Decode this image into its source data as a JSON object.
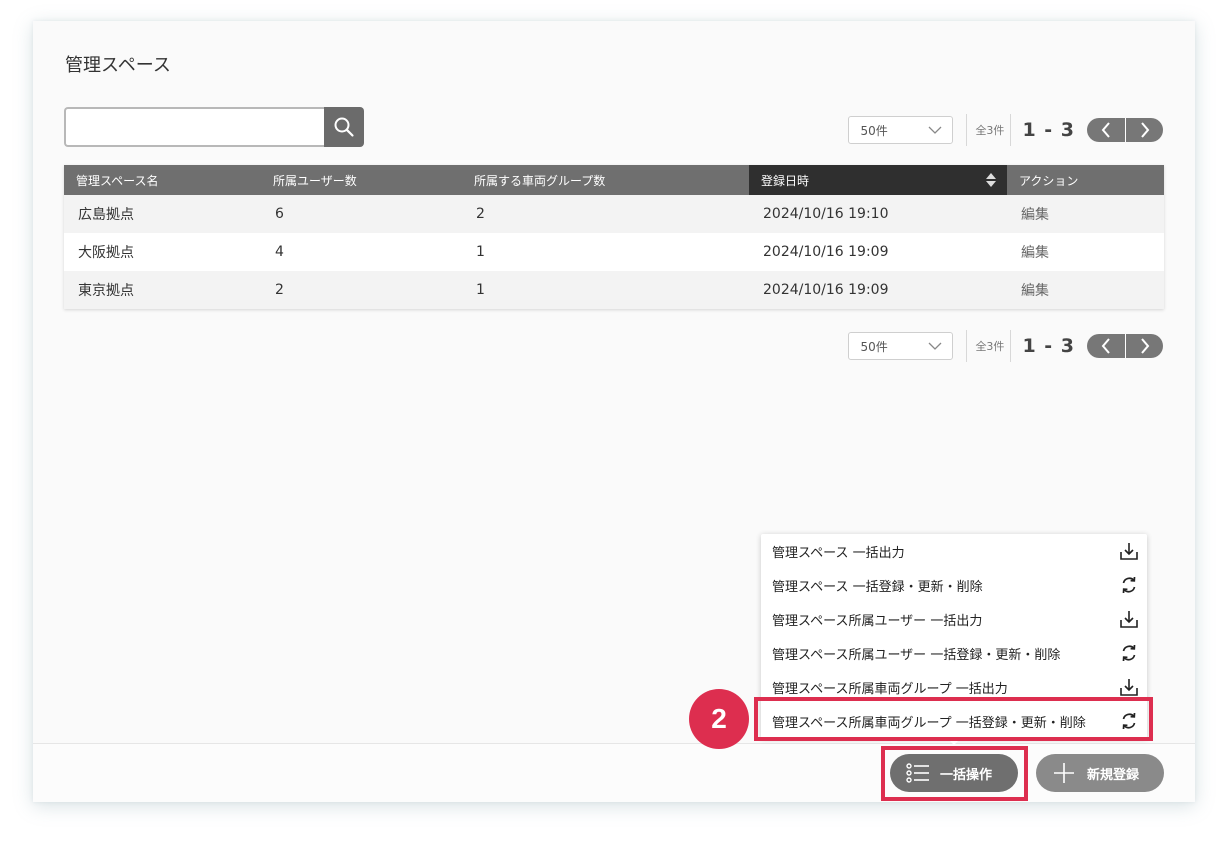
{
  "page": {
    "title": "管理スペース"
  },
  "search": {
    "value": "",
    "placeholder": "",
    "icon": "search-icon"
  },
  "pager": {
    "per_page": "50件",
    "total": "全3件",
    "range": "1 - 3"
  },
  "table": {
    "columns": [
      "管理スペース名",
      "所属ユーザー数",
      "所属する車両グループ数",
      "登録日時",
      "アクション"
    ],
    "sorted_column": "登録日時",
    "rows": [
      [
        "広島拠点",
        "6",
        "2",
        "2024/10/16 19:10",
        "編集"
      ],
      [
        "大阪拠点",
        "4",
        "1",
        "2024/10/16 19:09",
        "編集"
      ],
      [
        "東京拠点",
        "2",
        "1",
        "2024/10/16 19:09",
        "編集"
      ]
    ]
  },
  "menu": {
    "items": [
      {
        "label": "管理スペース 一括出力",
        "icon": "download-icon"
      },
      {
        "label": "管理スペース 一括登録・更新・削除",
        "icon": "refresh-icon"
      },
      {
        "label": "管理スペース所属ユーザー 一括出力",
        "icon": "download-icon"
      },
      {
        "label": "管理スペース所属ユーザー 一括登録・更新・削除",
        "icon": "refresh-icon"
      },
      {
        "label": "管理スペース所属車両グループ 一括出力",
        "icon": "download-icon"
      },
      {
        "label": "管理スペース所属車両グループ 一括登録・更新・削除",
        "icon": "refresh-icon"
      }
    ]
  },
  "footer": {
    "bulk_label": "一括操作",
    "new_label": "新規登録"
  },
  "annotation": {
    "step": "2",
    "color": "#dd2e4f"
  }
}
